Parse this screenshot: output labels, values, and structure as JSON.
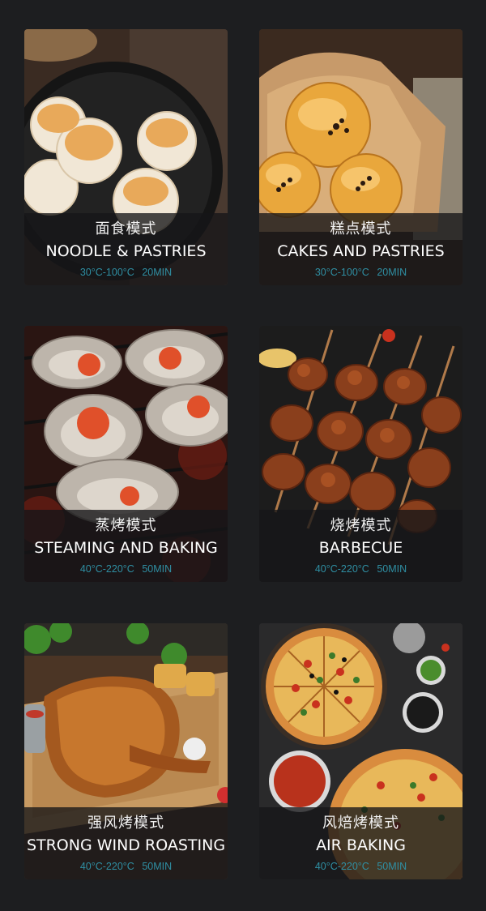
{
  "modes": [
    {
      "cn": "面食模式",
      "en": "NOODLE & PASTRIES",
      "temp": "30°C-100°C",
      "time": "20MIN"
    },
    {
      "cn": "糕点模式",
      "en": "CAKES AND PASTRIES",
      "temp": "30°C-100°C",
      "time": "20MIN"
    },
    {
      "cn": "蒸烤模式",
      "en": "STEAMING AND BAKING",
      "temp": "40°C-220°C",
      "time": "50MIN"
    },
    {
      "cn": "烧烤模式",
      "en": "BARBECUE",
      "temp": "40°C-220°C",
      "time": "50MIN"
    },
    {
      "cn": "强风烤模式",
      "en": "STRONG WIND ROASTING",
      "temp": "40°C-220°C",
      "time": "50MIN"
    },
    {
      "cn": "风焙烤模式",
      "en": "AIR BAKING",
      "temp": "40°C-220°C",
      "time": "50MIN"
    }
  ],
  "colors": {
    "background": "#1d1e20",
    "caption_overlay": "#161618",
    "spec_text": "#2f8fa3"
  },
  "images": {
    "noodle": "pan-fried-buns-photo",
    "cakes": "egg-yolk-pastry-photo",
    "steaming": "grilled-oysters-photo",
    "bbq": "meat-skewers-photo",
    "roasting": "roast-chicken-photo",
    "airbaking": "pizza-photo"
  }
}
